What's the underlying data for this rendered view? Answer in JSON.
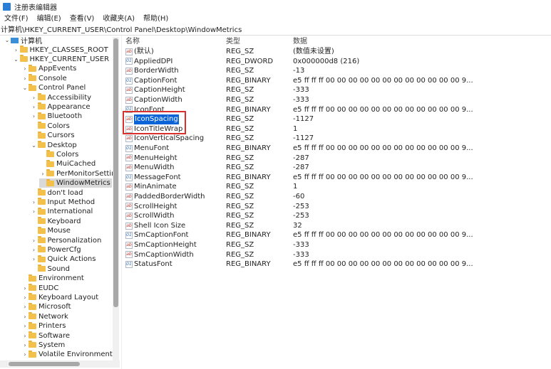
{
  "window": {
    "title": "注册表编辑器",
    "accent": "#0a64d8",
    "highlight_box_color": "#d9302c"
  },
  "menu": [
    "文件(F)",
    "编辑(E)",
    "查看(V)",
    "收藏夹(A)",
    "帮助(H)"
  ],
  "address": "计算机\\HKEY_CURRENT_USER\\Control Panel\\Desktop\\WindowMetrics",
  "tree": [
    {
      "label": "计算机",
      "level": 0,
      "state": "expanded",
      "icon": "computer-icon"
    },
    {
      "label": "HKEY_CLASSES_ROOT",
      "level": 1,
      "state": "collapsed"
    },
    {
      "label": "HKEY_CURRENT_USER",
      "level": 1,
      "state": "expanded"
    },
    {
      "label": "AppEvents",
      "level": 2,
      "state": "collapsed"
    },
    {
      "label": "Console",
      "level": 2,
      "state": "collapsed"
    },
    {
      "label": "Control Panel",
      "level": 2,
      "state": "expanded"
    },
    {
      "label": "Accessibility",
      "level": 3,
      "state": "collapsed"
    },
    {
      "label": "Appearance",
      "level": 3,
      "state": "collapsed"
    },
    {
      "label": "Bluetooth",
      "level": 3,
      "state": "collapsed"
    },
    {
      "label": "Colors",
      "level": 3,
      "state": "none"
    },
    {
      "label": "Cursors",
      "level": 3,
      "state": "none"
    },
    {
      "label": "Desktop",
      "level": 3,
      "state": "expanded"
    },
    {
      "label": "Colors",
      "level": 4,
      "state": "none"
    },
    {
      "label": "MuiCached",
      "level": 4,
      "state": "none"
    },
    {
      "label": "PerMonitorSettin",
      "level": 4,
      "state": "collapsed"
    },
    {
      "label": "WindowMetrics",
      "level": 4,
      "state": "none",
      "selected": true
    },
    {
      "label": "don't load",
      "level": 3,
      "state": "none"
    },
    {
      "label": "Input Method",
      "level": 3,
      "state": "collapsed"
    },
    {
      "label": "International",
      "level": 3,
      "state": "collapsed"
    },
    {
      "label": "Keyboard",
      "level": 3,
      "state": "none"
    },
    {
      "label": "Mouse",
      "level": 3,
      "state": "none"
    },
    {
      "label": "Personalization",
      "level": 3,
      "state": "collapsed"
    },
    {
      "label": "PowerCfg",
      "level": 3,
      "state": "collapsed"
    },
    {
      "label": "Quick Actions",
      "level": 3,
      "state": "collapsed"
    },
    {
      "label": "Sound",
      "level": 3,
      "state": "none"
    },
    {
      "label": "Environment",
      "level": 2,
      "state": "none"
    },
    {
      "label": "EUDC",
      "level": 2,
      "state": "collapsed"
    },
    {
      "label": "Keyboard Layout",
      "level": 2,
      "state": "collapsed"
    },
    {
      "label": "Microsoft",
      "level": 2,
      "state": "collapsed"
    },
    {
      "label": "Network",
      "level": 2,
      "state": "collapsed"
    },
    {
      "label": "Printers",
      "level": 2,
      "state": "collapsed"
    },
    {
      "label": "Software",
      "level": 2,
      "state": "collapsed"
    },
    {
      "label": "System",
      "level": 2,
      "state": "collapsed"
    },
    {
      "label": "Volatile Environment",
      "level": 2,
      "state": "collapsed"
    }
  ],
  "columns": [
    "名称",
    "类型",
    "数据"
  ],
  "values": [
    {
      "name": "(默认)",
      "type": "REG_SZ",
      "data": "(数值未设置)"
    },
    {
      "name": "AppliedDPI",
      "type": "REG_DWORD",
      "data": "0x000000d8 (216)"
    },
    {
      "name": "BorderWidth",
      "type": "REG_SZ",
      "data": "-13"
    },
    {
      "name": "CaptionFont",
      "type": "REG_BINARY",
      "data": "e5 ff ff ff 00 00 00 00 00 00 00 00 00 00 00 00 9..."
    },
    {
      "name": "CaptionHeight",
      "type": "REG_SZ",
      "data": "-333"
    },
    {
      "name": "CaptionWidth",
      "type": "REG_SZ",
      "data": "-333"
    },
    {
      "name": "IconFont",
      "type": "REG_BINARY",
      "data": "e5 ff ff ff 00 00 00 00 00 00 00 00 00 00 00 00 9..."
    },
    {
      "name": "IconSpacing",
      "type": "REG_SZ",
      "data": "-1127",
      "selected": true
    },
    {
      "name": "IconTitleWrap",
      "type": "REG_SZ",
      "data": "1"
    },
    {
      "name": "IconVerticalSpacing",
      "type": "REG_SZ",
      "data": "-1127"
    },
    {
      "name": "MenuFont",
      "type": "REG_BINARY",
      "data": "e5 ff ff ff 00 00 00 00 00 00 00 00 00 00 00 00 9..."
    },
    {
      "name": "MenuHeight",
      "type": "REG_SZ",
      "data": "-287"
    },
    {
      "name": "MenuWidth",
      "type": "REG_SZ",
      "data": "-287"
    },
    {
      "name": "MessageFont",
      "type": "REG_BINARY",
      "data": "e5 ff ff ff 00 00 00 00 00 00 00 00 00 00 00 00 9..."
    },
    {
      "name": "MinAnimate",
      "type": "REG_SZ",
      "data": "1"
    },
    {
      "name": "PaddedBorderWidth",
      "type": "REG_SZ",
      "data": "-60"
    },
    {
      "name": "ScrollHeight",
      "type": "REG_SZ",
      "data": "-253"
    },
    {
      "name": "ScrollWidth",
      "type": "REG_SZ",
      "data": "-253"
    },
    {
      "name": "Shell Icon Size",
      "type": "REG_SZ",
      "data": "32"
    },
    {
      "name": "SmCaptionFont",
      "type": "REG_BINARY",
      "data": "e5 ff ff ff 00 00 00 00 00 00 00 00 00 00 00 00 9..."
    },
    {
      "name": "SmCaptionHeight",
      "type": "REG_SZ",
      "data": "-333"
    },
    {
      "name": "SmCaptionWidth",
      "type": "REG_SZ",
      "data": "-333"
    },
    {
      "name": "StatusFont",
      "type": "REG_BINARY",
      "data": "e5 ff ff ff 00 00 00 00 00 00 00 00 00 00 00 00 9..."
    }
  ]
}
